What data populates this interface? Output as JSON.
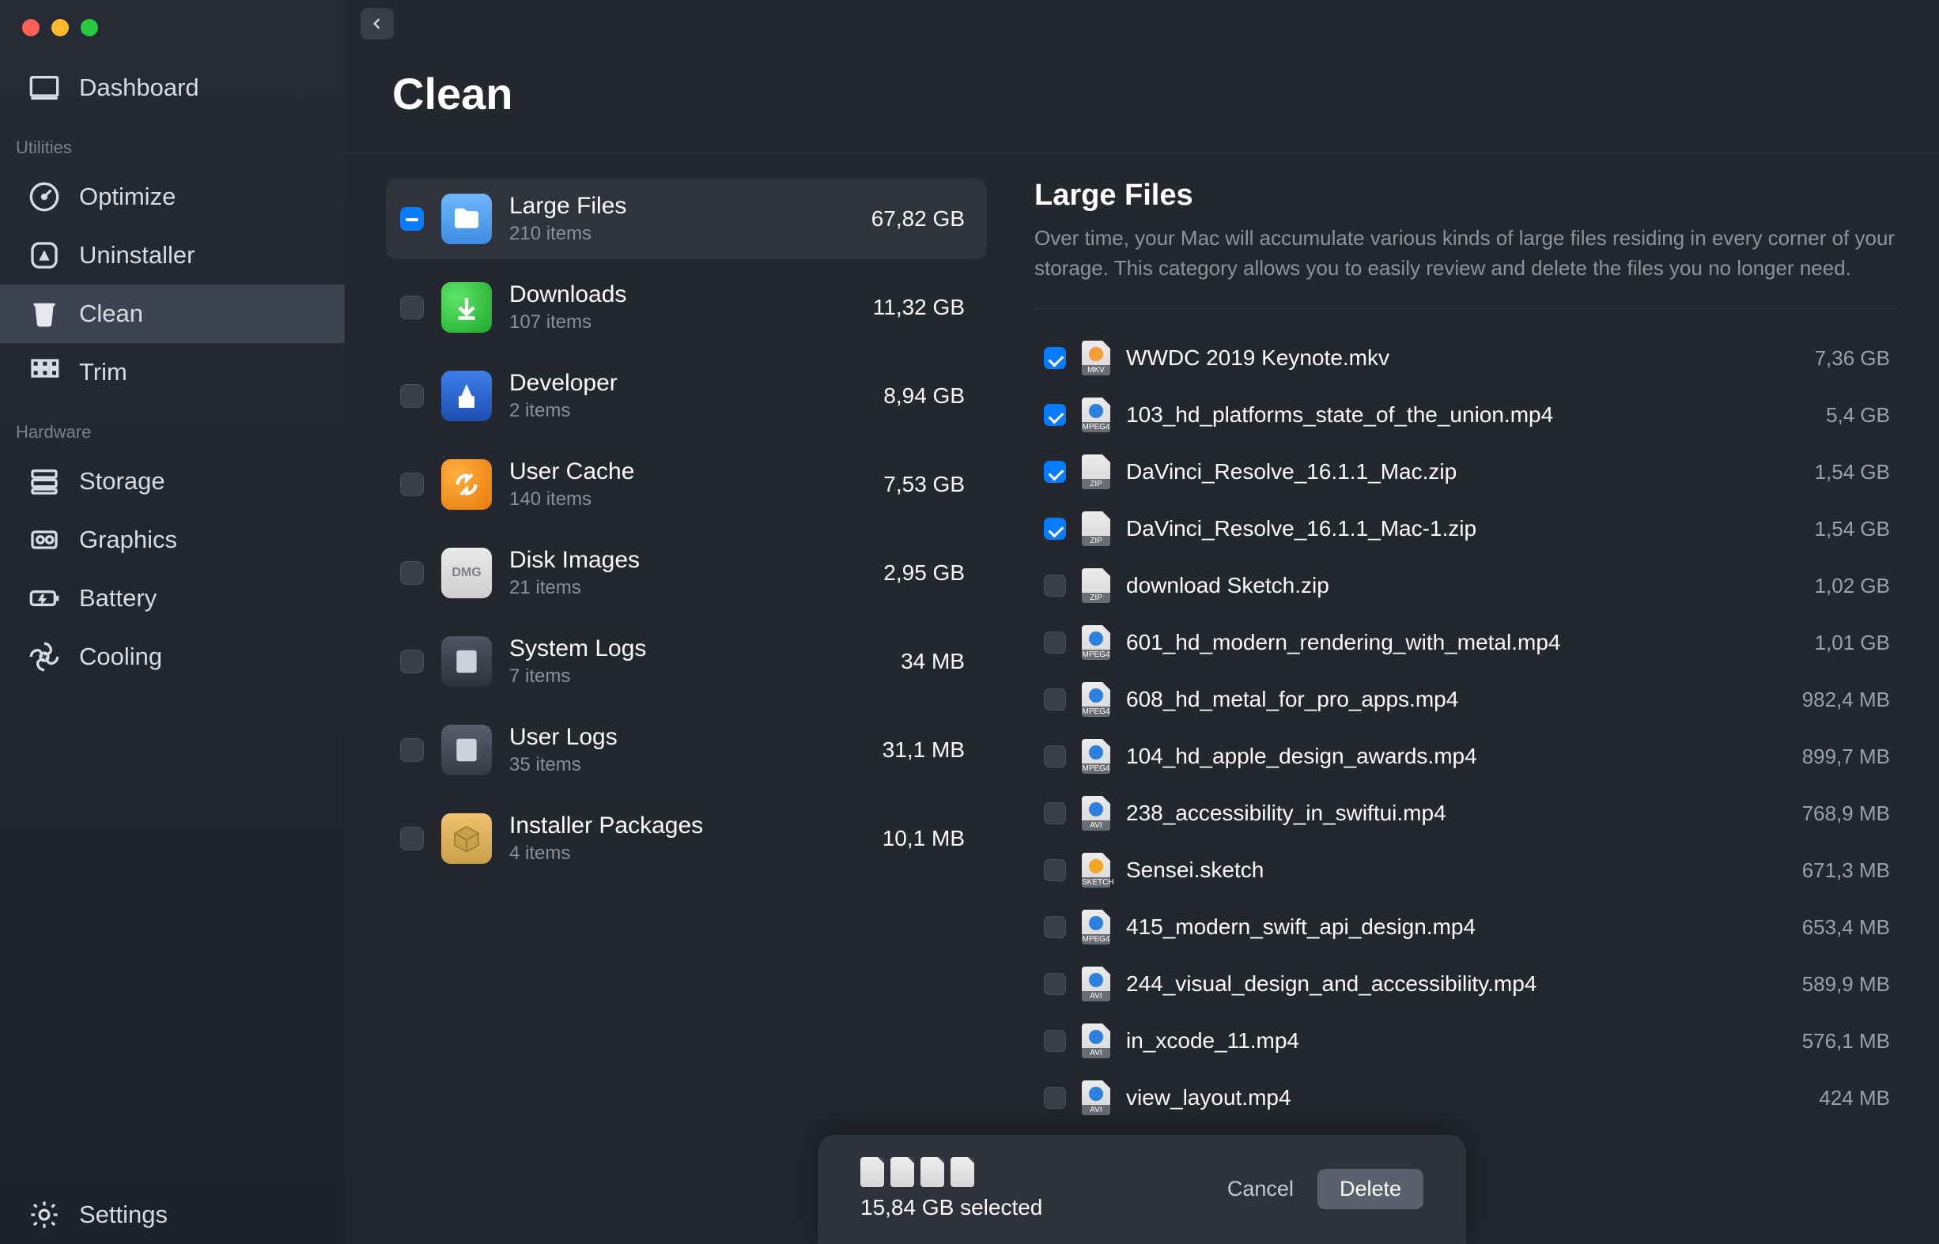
{
  "sidebar": {
    "top_item": {
      "label": "Dashboard"
    },
    "section1_title": "Utilities",
    "section1_items": [
      {
        "label": "Optimize"
      },
      {
        "label": "Uninstaller"
      },
      {
        "label": "Clean"
      },
      {
        "label": "Trim"
      }
    ],
    "section2_title": "Hardware",
    "section2_items": [
      {
        "label": "Storage"
      },
      {
        "label": "Graphics"
      },
      {
        "label": "Battery"
      },
      {
        "label": "Cooling"
      }
    ],
    "bottom_item": {
      "label": "Settings"
    }
  },
  "page_title": "Clean",
  "categories": [
    {
      "name": "Large Files",
      "sub": "210 items",
      "size": "67,82 GB",
      "state": "indeterminate",
      "icon": "folder"
    },
    {
      "name": "Downloads",
      "sub": "107 items",
      "size": "11,32 GB",
      "state": "off",
      "icon": "downloads"
    },
    {
      "name": "Developer",
      "sub": "2 items",
      "size": "8,94 GB",
      "state": "off",
      "icon": "developer"
    },
    {
      "name": "User Cache",
      "sub": "140 items",
      "size": "7,53 GB",
      "state": "off",
      "icon": "cache"
    },
    {
      "name": "Disk Images",
      "sub": "21 items",
      "size": "2,95 GB",
      "state": "off",
      "icon": "dmg"
    },
    {
      "name": "System Logs",
      "sub": "7 items",
      "size": "34 MB",
      "state": "off",
      "icon": "syslogs"
    },
    {
      "name": "User Logs",
      "sub": "35 items",
      "size": "31,1 MB",
      "state": "off",
      "icon": "userlogs"
    },
    {
      "name": "Installer Packages",
      "sub": "4 items",
      "size": "10,1 MB",
      "state": "off",
      "icon": "pkg"
    }
  ],
  "selected_category": 0,
  "details": {
    "title": "Large Files",
    "description": "Over time, your Mac will accumulate various kinds of large files residing in every corner of your storage. This category allows you to easily review and delete the files you no longer need."
  },
  "files": [
    {
      "name": "WWDC 2019 Keynote.mkv",
      "size": "7,36 GB",
      "checked": true,
      "badge": "MKV",
      "dot": "#f29d38"
    },
    {
      "name": "103_hd_platforms_state_of_the_union.mp4",
      "size": "5,4 GB",
      "checked": true,
      "badge": "MPEG4",
      "dot": "#2d7fe0"
    },
    {
      "name": "DaVinci_Resolve_16.1.1_Mac.zip",
      "size": "1,54 GB",
      "checked": true,
      "badge": "ZIP",
      "dot": ""
    },
    {
      "name": "DaVinci_Resolve_16.1.1_Mac-1.zip",
      "size": "1,54 GB",
      "checked": true,
      "badge": "ZIP",
      "dot": ""
    },
    {
      "name": "download Sketch.zip",
      "size": "1,02 GB",
      "checked": false,
      "badge": "ZIP",
      "dot": ""
    },
    {
      "name": "601_hd_modern_rendering_with_metal.mp4",
      "size": "1,01 GB",
      "checked": false,
      "badge": "MPEG4",
      "dot": "#2d7fe0"
    },
    {
      "name": "608_hd_metal_for_pro_apps.mp4",
      "size": "982,4 MB",
      "checked": false,
      "badge": "MPEG4",
      "dot": "#2d7fe0"
    },
    {
      "name": "104_hd_apple_design_awards.mp4",
      "size": "899,7 MB",
      "checked": false,
      "badge": "MPEG4",
      "dot": "#2d7fe0"
    },
    {
      "name": "238_accessibility_in_swiftui.mp4",
      "size": "768,9 MB",
      "checked": false,
      "badge": "AVI",
      "dot": "#2d7fe0"
    },
    {
      "name": "Sensei.sketch",
      "size": "671,3 MB",
      "checked": false,
      "badge": "SKETCH",
      "dot": "#f5a623"
    },
    {
      "name": "415_modern_swift_api_design.mp4",
      "size": "653,4 MB",
      "checked": false,
      "badge": "MPEG4",
      "dot": "#2d7fe0"
    },
    {
      "name": "244_visual_design_and_accessibility.mp4",
      "size": "589,9 MB",
      "checked": false,
      "badge": "AVI",
      "dot": "#2d7fe0"
    },
    {
      "name": "in_xcode_11.mp4",
      "size": "576,1 MB",
      "checked": false,
      "badge": "AVI",
      "dot": "#2d7fe0"
    },
    {
      "name": "view_layout.mp4",
      "size": "424 MB",
      "checked": false,
      "badge": "AVI",
      "dot": "#2d7fe0"
    }
  ],
  "action_bar": {
    "selected_text": "15,84 GB selected",
    "cancel_label": "Cancel",
    "delete_label": "Delete"
  }
}
